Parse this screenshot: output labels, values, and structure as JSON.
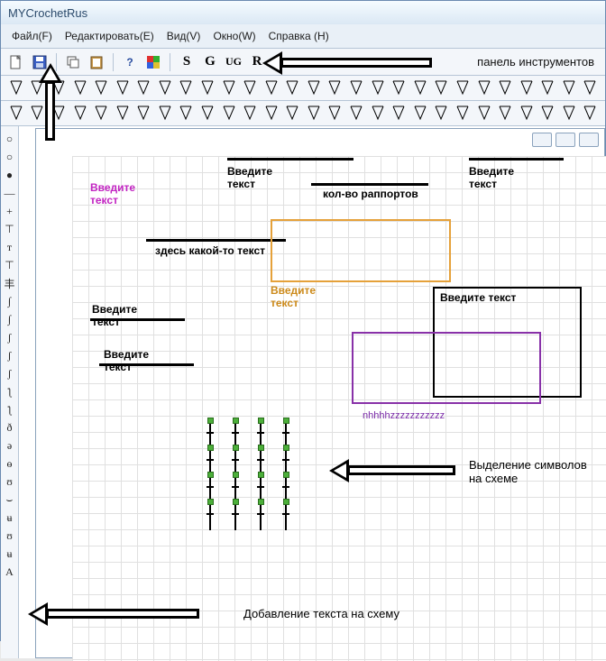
{
  "title": "MYCrochetRus",
  "menu": {
    "file": "Файл(F)",
    "edit": "Редактировать(E)",
    "view": "Вид(V)",
    "window": "Окно(W)",
    "help": "Справка (H)"
  },
  "toolbar": {
    "letters": [
      "S",
      "G",
      "UG",
      "R"
    ],
    "label_panel": "панель инструментов"
  },
  "sidebar_tail": "A",
  "canvas": {
    "prompt1": "Введите\nтекст",
    "prompt2": "Введите\nтекст",
    "rapport": "кол-во раппортов",
    "some_text": "здесь какой-то текст",
    "prompt3": "Введите\nтекст",
    "prompt4": "Введите\nтекст",
    "prompt5": "Введите\nтекст",
    "prompt6": "Введите текст",
    "prompt7": "Введите\nтекст",
    "nz": "nhhhhzzzzzzzzzzz"
  },
  "annot": {
    "selection": "Выделение символов\nна схеме",
    "addtext": "Добавление текста на схему"
  }
}
